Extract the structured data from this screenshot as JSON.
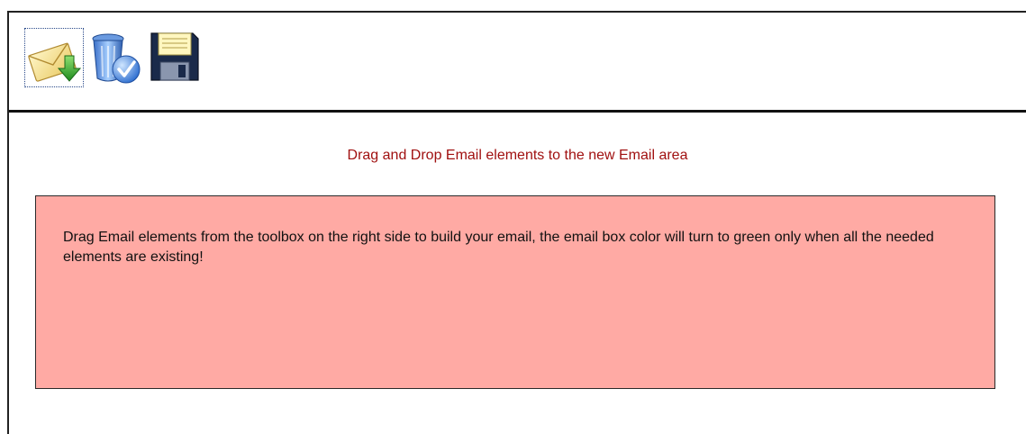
{
  "toolbar": {
    "buttons": [
      {
        "icon": "envelope-receive-icon",
        "selected": true
      },
      {
        "icon": "recycle-bin-icon",
        "selected": false
      },
      {
        "icon": "floppy-disk-icon",
        "selected": false
      }
    ]
  },
  "instruction": "Drag and Drop Email elements to the new Email area",
  "email_box": {
    "message": "Drag Email elements from the toolbox on the right side to build your email, the email box color will turn to green only when all the needed elements are existing!",
    "background_color": "#ffaaa4"
  },
  "colors": {
    "instruction_text": "#a01010"
  }
}
